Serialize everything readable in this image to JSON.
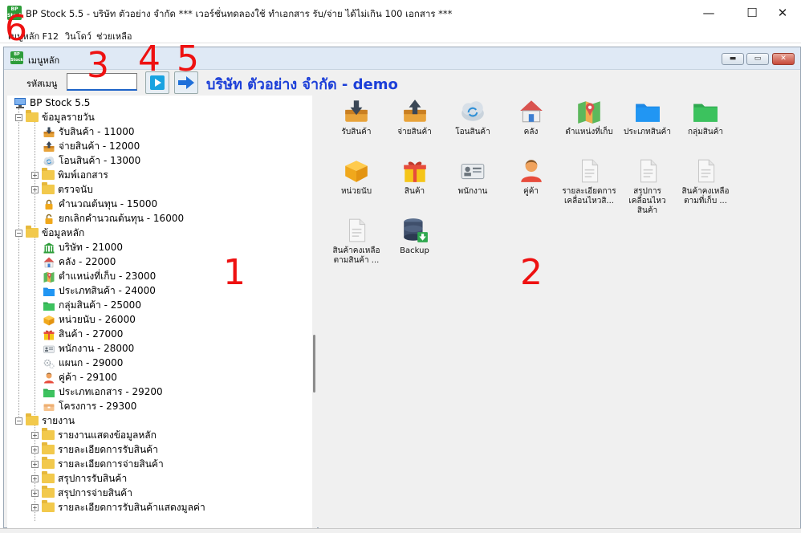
{
  "window": {
    "title": "BP Stock 5.5 - บริษัท ตัวอย่าง จำกัด *** เวอร์ชั่นทดลองใช้ ทำเอกสาร รับ/จ่าย ได้ไม่เกิน 100 เอกสาร ***",
    "logo_text": "BP Stock",
    "min": "—",
    "max": "☐",
    "close": "✕"
  },
  "menu": [
    "เมนูหลัก F12",
    "วินโดว์",
    "ช่วยเหลือ"
  ],
  "child": {
    "title": "เมนูหลัก",
    "logo_text": "BP Stock"
  },
  "toolbar": {
    "code_label": "รหัสเมนู",
    "code_value": "",
    "company": "บริษัท ตัวอย่าง จำกัด - demo"
  },
  "annotations": [
    "1",
    "2",
    "3",
    "4",
    "5",
    "6"
  ],
  "tree": {
    "root": "BP Stock 5.5",
    "groups": [
      {
        "label": "ข้อมูลรายวัน",
        "items": [
          {
            "label": "รับสินค้า - 11000",
            "icon": "receive-icon"
          },
          {
            "label": "จ่ายสินค้า - 12000",
            "icon": "issue-icon"
          },
          {
            "label": "โอนสินค้า - 13000",
            "icon": "transfer-icon"
          },
          {
            "label": "พิมพ์เอกสาร",
            "icon": "folder-icon",
            "expand": true
          },
          {
            "label": "ตรวจนับ",
            "icon": "folder-icon",
            "expand": true
          },
          {
            "label": "คำนวณต้นทุน - 15000",
            "icon": "lock-icon"
          },
          {
            "label": "ยกเลิกคำนวณต้นทุน - 16000",
            "icon": "unlock-icon"
          }
        ]
      },
      {
        "label": "ข้อมูลหลัก",
        "items": [
          {
            "label": "บริษัท - 21000",
            "icon": "company-icon"
          },
          {
            "label": "คลัง - 22000",
            "icon": "warehouse-icon"
          },
          {
            "label": "ตำแหน่งที่เก็บ - 23000",
            "icon": "map-icon"
          },
          {
            "label": "ประเภทสินค้า - 24000",
            "icon": "blue-folder-icon"
          },
          {
            "label": "กลุ่มสินค้า - 25000",
            "icon": "green-folder-icon"
          },
          {
            "label": "หน่วยนับ - 26000",
            "icon": "unit-box-icon"
          },
          {
            "label": "สินค้า - 27000",
            "icon": "gift-icon"
          },
          {
            "label": "พนักงาน - 28000",
            "icon": "id-card-icon"
          },
          {
            "label": "แผนก - 29000",
            "icon": "gears-icon"
          },
          {
            "label": "คู่ค้า - 29100",
            "icon": "partner-icon"
          },
          {
            "label": "ประเภทเอกสาร - 29200",
            "icon": "green-folder-icon"
          },
          {
            "label": "โครงการ - 29300",
            "icon": "project-icon"
          }
        ]
      },
      {
        "label": "รายงาน",
        "items": [
          {
            "label": "รายงานแสดงข้อมูลหลัก",
            "icon": "folder-icon",
            "expand": true
          },
          {
            "label": "รายละเอียดการรับสินค้า",
            "icon": "folder-icon",
            "expand": true
          },
          {
            "label": "รายละเอียดการจ่ายสินค้า",
            "icon": "folder-icon",
            "expand": true
          },
          {
            "label": "สรุปการรับสินค้า",
            "icon": "folder-icon",
            "expand": true
          },
          {
            "label": "สรุปการจ่ายสินค้า",
            "icon": "folder-icon",
            "expand": true
          },
          {
            "label": "รายละเอียดการรับสินค้าแสดงมูลค่า",
            "icon": "folder-icon",
            "expand": true
          }
        ]
      }
    ]
  },
  "shortcuts": [
    {
      "label": "รับสินค้า",
      "icon": "receive-icon"
    },
    {
      "label": "จ่ายสินค้า",
      "icon": "issue-icon"
    },
    {
      "label": "โอนสินค้า",
      "icon": "transfer-icon"
    },
    {
      "label": "คลัง",
      "icon": "warehouse-icon"
    },
    {
      "label": "ตำแหน่งที่เก็บ",
      "icon": "map-icon"
    },
    {
      "label": "ประเภทสินค้า",
      "icon": "blue-folder-icon"
    },
    {
      "label": "กลุ่มสินค้า",
      "icon": "green-folder-icon"
    },
    {
      "label": "หน่วยนับ",
      "icon": "unit-box-icon"
    },
    {
      "label": "สินค้า",
      "icon": "gift-icon"
    },
    {
      "label": "พนักงาน",
      "icon": "id-card-icon"
    },
    {
      "label": "คู่ค้า",
      "icon": "partner-icon"
    },
    {
      "label": "รายละเอียดการเคลื่อนไหวสิ...",
      "icon": "document-icon"
    },
    {
      "label": "สรุปการเคลื่อนไหวสินค้า",
      "icon": "document-icon"
    },
    {
      "label": "สินค้าคงเหลือตามที่เก็บ ...",
      "icon": "document-icon"
    },
    {
      "label": "สินค้าคงเหลือตามสินค้า ...",
      "icon": "document-icon"
    },
    {
      "label": "Backup",
      "icon": "database-icon"
    }
  ]
}
